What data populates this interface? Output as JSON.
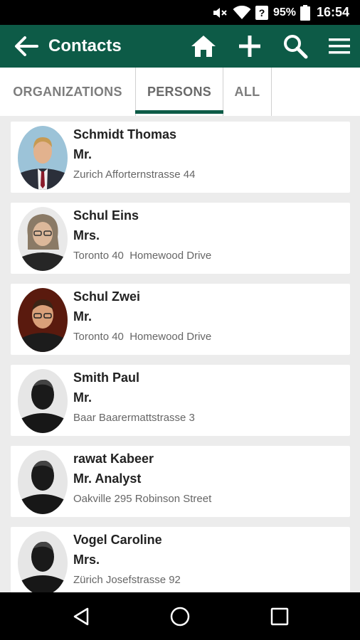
{
  "status_bar": {
    "battery_percent": "95%",
    "time": "16:54",
    "icons": [
      "mute-icon",
      "wifi-icon",
      "signal-unknown-icon",
      "battery-icon"
    ]
  },
  "app_bar": {
    "title": "Contacts",
    "background_color": "#0d5b47",
    "icons": [
      "back-arrow-icon",
      "home-icon",
      "plus-icon",
      "search-icon",
      "hamburger-menu-icon"
    ]
  },
  "tabs": {
    "items": [
      {
        "label": "ORGANIZATIONS",
        "selected": false
      },
      {
        "label": "PERSONS",
        "selected": true
      },
      {
        "label": "ALL",
        "selected": false
      }
    ],
    "indicator_color": "#0d5b47"
  },
  "contacts": [
    {
      "name": "Schmidt Thomas",
      "salutation": "Mr.",
      "address": "Zurich Afforternstrasse 44",
      "avatar": "photo-man-suit"
    },
    {
      "name": "Schul Eins",
      "salutation": "Mrs.",
      "address": "Toronto 40  Homewood Drive",
      "avatar": "photo-woman-glasses"
    },
    {
      "name": "Schul Zwei",
      "salutation": "Mr.",
      "address": "Toronto 40  Homewood Drive",
      "avatar": "photo-man-glasses"
    },
    {
      "name": "Smith Paul",
      "salutation": "Mr.",
      "address": "Baar Baarermattstrasse 3",
      "avatar": "placeholder-silhouette"
    },
    {
      "name": "rawat Kabeer",
      "salutation": "Mr. Analyst",
      "address": "Oakville 295 Robinson Street",
      "avatar": "placeholder-silhouette"
    },
    {
      "name": "Vogel Caroline",
      "salutation": "Mrs.",
      "address": "Zürich Josefstrasse 92",
      "avatar": "placeholder-silhouette"
    }
  ],
  "nav_bar": {
    "icons": [
      "nav-back-icon",
      "nav-home-icon",
      "nav-recents-icon"
    ]
  }
}
